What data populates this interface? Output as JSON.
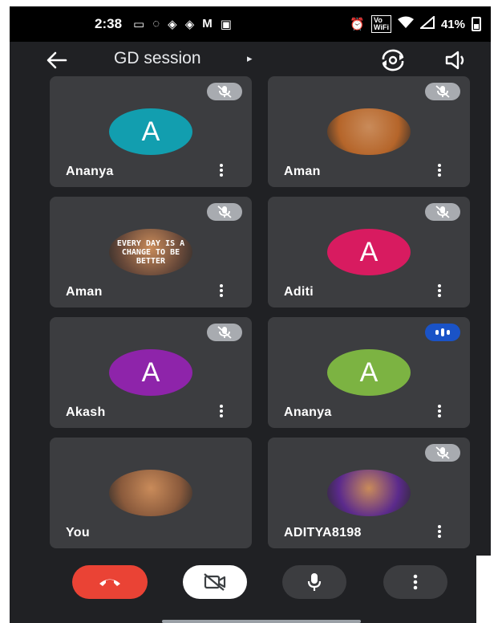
{
  "status_bar": {
    "time": "2:38",
    "battery": "41%",
    "wifi_badge": "Vo WiFi"
  },
  "header": {
    "title": "GD session",
    "caret": "▸"
  },
  "participants": [
    {
      "name": "Ananya",
      "avatar_letter": "A",
      "avatar_color": "#129eaf",
      "status": "muted"
    },
    {
      "name": "Aman",
      "avatar_letter": "",
      "avatar_color": "#b5652a",
      "status": "muted"
    },
    {
      "name": "Aman",
      "avatar_letter": "",
      "avatar_color": "#6a4a3a",
      "status": "muted",
      "avatar_text": "EVERY DAY IS A CHANGE TO BE BETTER"
    },
    {
      "name": "Aditi",
      "avatar_letter": "A",
      "avatar_color": "#d81b60",
      "status": "muted"
    },
    {
      "name": "Akash",
      "avatar_letter": "A",
      "avatar_color": "#8e24aa",
      "status": "muted"
    },
    {
      "name": "Ananya",
      "avatar_letter": "A",
      "avatar_color": "#7cb342",
      "status": "speaking"
    },
    {
      "name": "You",
      "avatar_letter": "",
      "avatar_color": "#8a5a3c",
      "status": "none"
    },
    {
      "name": "ADITYA8198",
      "avatar_letter": "",
      "avatar_color": "#5b2a8c",
      "status": "muted"
    }
  ],
  "colors": {
    "background": "#202124",
    "tile": "#3c3d40",
    "end_call": "#ea4335",
    "speaking_badge": "#1a53c7"
  }
}
